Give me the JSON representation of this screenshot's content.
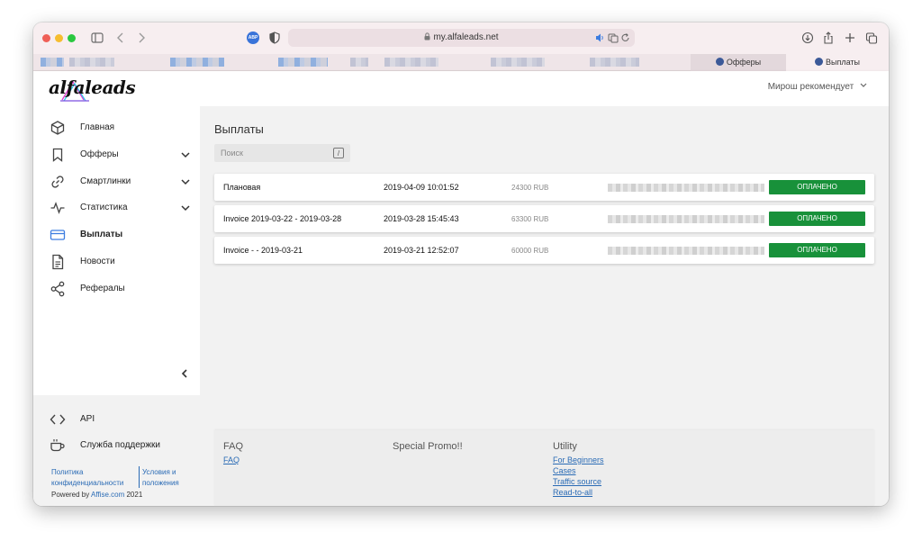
{
  "browser": {
    "url": "my.alfaleads.net",
    "tabs": [
      {
        "label": "Офферы",
        "active": false
      },
      {
        "label": "Выплаты",
        "active": true
      }
    ]
  },
  "app": {
    "logo_text": "alfaleads",
    "user_menu": "Мирош рекомендует",
    "accent_color": "#3d7de0",
    "success_color": "#18913a"
  },
  "sidebar": {
    "items": [
      {
        "label": "Главная",
        "icon": "cube-icon"
      },
      {
        "label": "Офферы",
        "icon": "bookmark-icon",
        "expandable": true
      },
      {
        "label": "Смартлинки",
        "icon": "link-icon",
        "expandable": true
      },
      {
        "label": "Статистика",
        "icon": "pulse-icon",
        "expandable": true
      },
      {
        "label": "Выплаты",
        "icon": "card-icon",
        "active": true
      },
      {
        "label": "Новости",
        "icon": "document-icon"
      },
      {
        "label": "Рефералы",
        "icon": "share-icon"
      }
    ],
    "bottom": {
      "api_label": "API",
      "support_label": "Служба поддержки",
      "privacy_line1": "Политика",
      "privacy_line2": "конфиденциальности",
      "terms_line1": "Условия и",
      "terms_line2": "положения",
      "powered_prefix": "Powered by",
      "powered_link": "Affise.com",
      "powered_year": "2021"
    }
  },
  "main": {
    "title": "Выплаты",
    "search_placeholder": "Поиск",
    "search_key": "/",
    "payouts": [
      {
        "name": "Плановая",
        "date": "2019-04-09 10:01:52",
        "amount": "24300 RUB",
        "status": "ОПЛАЧЕНО"
      },
      {
        "name": "Invoice 2019-03-22 - 2019-03-28",
        "date": "2019-03-28 15:45:43",
        "amount": "63300 RUB",
        "status": "ОПЛАЧЕНО"
      },
      {
        "name": "Invoice - - 2019-03-21",
        "date": "2019-03-21 12:52:07",
        "amount": "60000 RUB",
        "status": "ОПЛАЧЕНО"
      }
    ]
  },
  "footer": {
    "faq_heading": "FAQ",
    "faq_links": [
      "FAQ"
    ],
    "promo_heading": "Special Promo!!",
    "utility_heading": "Utility",
    "utility_links": [
      "For Beginners",
      "Cases",
      "Traffic source",
      "Read-to-all"
    ]
  }
}
